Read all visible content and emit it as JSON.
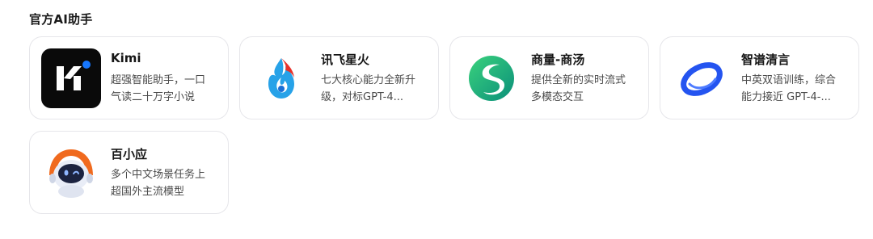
{
  "section": {
    "title": "官方AI助手"
  },
  "assistants": [
    {
      "name": "Kimi",
      "desc_line1": "超强智能助手，一口",
      "desc_line2": "气读二十万字小说",
      "icon": "kimi-logo-icon",
      "accent": "#1677ff"
    },
    {
      "name": "讯飞星火",
      "desc_line1": "七大核心能力全新升",
      "desc_line2": "级，对标GPT-4...",
      "icon": "spark-flame-logo-icon",
      "accent": "#e8312a"
    },
    {
      "name": "商量-商汤",
      "desc_line1": "提供全新的实时流式",
      "desc_line2": "多模态交互",
      "icon": "sensechat-s-logo-icon",
      "accent": "#18b36b"
    },
    {
      "name": "智谱清言",
      "desc_line1": "中英双语训练，综合",
      "desc_line2": "能力接近 GPT-4-...",
      "icon": "zhipu-ring-logo-icon",
      "accent": "#2454f0"
    },
    {
      "name": "百小应",
      "desc_line1": "多个中文场景任务上",
      "desc_line2": "超国外主流模型",
      "icon": "robot-avatar-logo-icon",
      "accent": "#f06a1e"
    }
  ]
}
